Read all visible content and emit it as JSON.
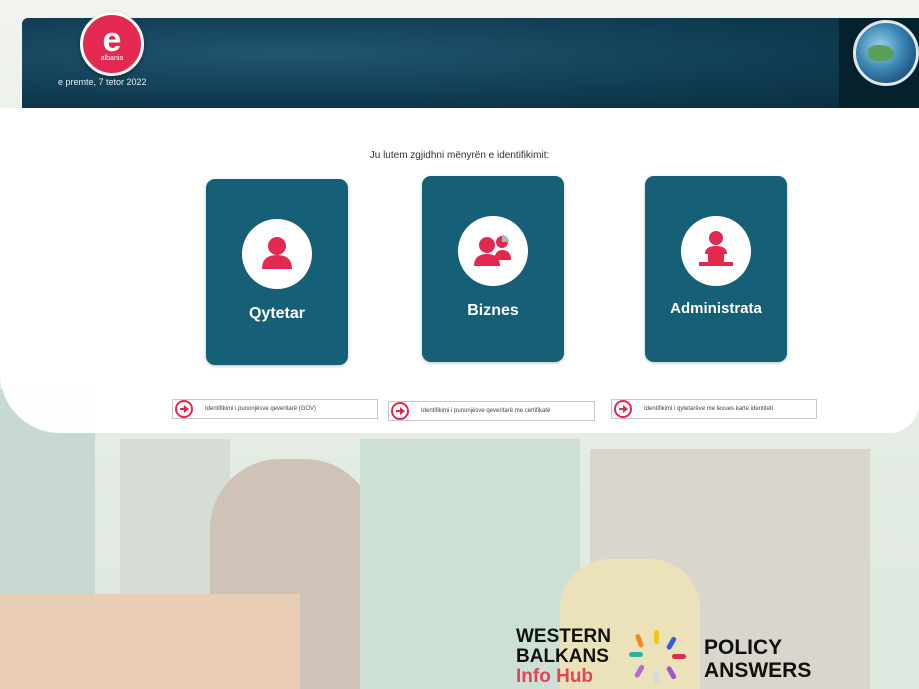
{
  "header": {
    "logo_letter": "e",
    "logo_sub": "albania",
    "date": "e premte, 7 tetor 2022"
  },
  "main": {
    "prompt": "Ju lutem zgjidhni mënyrën e identifikimit:",
    "options": [
      {
        "label": "Qytetar",
        "icon": "user-icon"
      },
      {
        "label": "Biznes",
        "icon": "business-users-icon"
      },
      {
        "label": "Administrata",
        "icon": "administration-desk-icon"
      }
    ],
    "links": [
      {
        "text": "Identifikimi i punonjësve qeveritarë (GOV)",
        "icon": "arrow-right-circle-icon"
      },
      {
        "text": "Identifikimi i punonjësve qeveritarë me certifikatë",
        "icon": "arrow-right-circle-icon"
      },
      {
        "text": "Identifikimi i qytetarëve me lexues karte identiteti",
        "icon": "arrow-right-circle-icon"
      }
    ]
  },
  "footer": {
    "wb_line1": "WESTERN",
    "wb_line2": "BALKANS",
    "wb_line3": "Info Hub",
    "pa_line1": "POLICY",
    "pa_line2": "ANSWERS"
  },
  "colors": {
    "header_bg": "#0f3b50",
    "card_bg": "#155f77",
    "accent": "#e32950",
    "hub_red": "#e0455a"
  }
}
